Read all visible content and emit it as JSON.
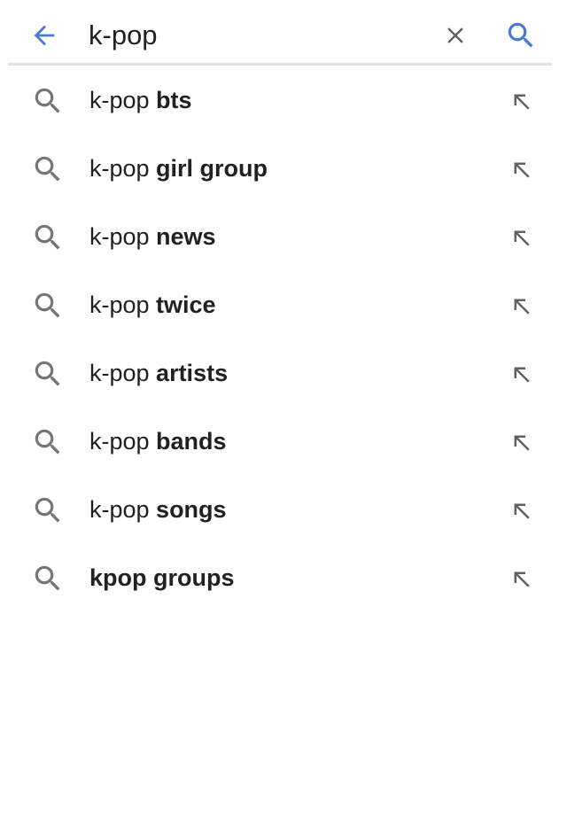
{
  "search": {
    "query": "k-pop",
    "back_icon": "arrow-left-icon",
    "clear_icon": "close-icon",
    "submit_icon": "search-icon",
    "accent_color": "#4a7bd0",
    "icon_gray": "#616161"
  },
  "suggestions": [
    {
      "prefix": "k-pop ",
      "completion": "bts",
      "icon": "search-icon",
      "fill_icon": "arrow-up-left-icon"
    },
    {
      "prefix": "k-pop ",
      "completion": "girl group",
      "icon": "search-icon",
      "fill_icon": "arrow-up-left-icon"
    },
    {
      "prefix": "k-pop ",
      "completion": "news",
      "icon": "search-icon",
      "fill_icon": "arrow-up-left-icon"
    },
    {
      "prefix": "k-pop ",
      "completion": "twice",
      "icon": "search-icon",
      "fill_icon": "arrow-up-left-icon"
    },
    {
      "prefix": "k-pop ",
      "completion": "artists",
      "icon": "search-icon",
      "fill_icon": "arrow-up-left-icon"
    },
    {
      "prefix": "k-pop ",
      "completion": "bands",
      "icon": "search-icon",
      "fill_icon": "arrow-up-left-icon"
    },
    {
      "prefix": "k-pop ",
      "completion": "songs",
      "icon": "search-icon",
      "fill_icon": "arrow-up-left-icon"
    },
    {
      "prefix": "",
      "completion": "kpop groups",
      "icon": "search-icon",
      "fill_icon": "arrow-up-left-icon"
    }
  ]
}
